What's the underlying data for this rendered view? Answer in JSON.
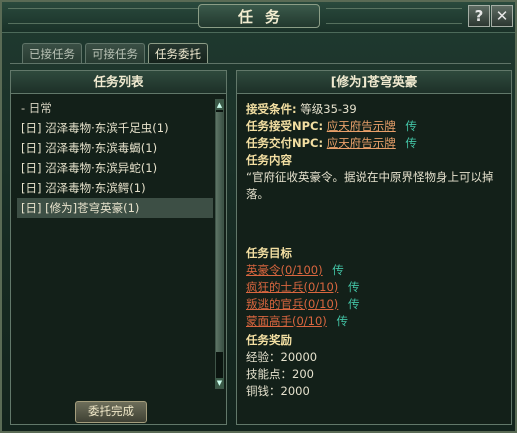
{
  "window": {
    "title": "任务"
  },
  "header": {
    "help_icon": "question-icon",
    "close_icon": "close-icon"
  },
  "tabs": [
    {
      "label": "已接任务"
    },
    {
      "label": "可接任务"
    },
    {
      "label": "任务委托"
    }
  ],
  "left": {
    "title": "任务列表",
    "category": "- 日常",
    "items": [
      "[日] 沼泽毒物·东滨千足虫(1)",
      "[日] 沼泽毒物·东滨毒蝎(1)",
      "[日] 沼泽毒物·东滨异蛇(1)",
      "[日] 沼泽毒物·东滨鳄(1)",
      "[日] [修为]苍穹英豪(1)"
    ],
    "button": "委托完成"
  },
  "detail": {
    "title": "[修为]苍穹英豪",
    "cond_label": "接受条件:",
    "cond_value": "等级35-39",
    "accept_label": "任务接受NPC:",
    "accept_npc": "应天府告示牌",
    "submit_label": "任务交付NPC:",
    "submit_npc": "应天府告示牌",
    "send": "传",
    "content_label": "任务内容",
    "content_text": "“官府征收英豪令。据说在中原界怪物身上可以掉落。",
    "target_label": "任务目标",
    "targets": [
      "英豪令(0/100)",
      "疯狂的士兵(0/10)",
      "叛逃的官兵(0/10)",
      "蒙面高手(0/10)"
    ],
    "reward_label": "任务奖励",
    "rewards": [
      "经验：20000",
      "技能点：200",
      "铜钱：2000"
    ]
  }
}
